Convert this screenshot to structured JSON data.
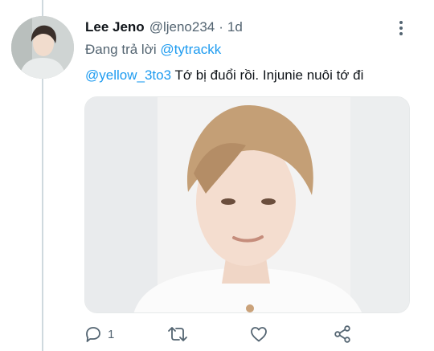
{
  "tweet": {
    "display_name": "Lee Jeno",
    "handle": "@ljeno234",
    "separator": "·",
    "time": "1d",
    "replying_prefix": "Đang trả lời",
    "replying_to": "@tytrackk",
    "mention": "@yellow_3to3",
    "text": "Tớ bị đuổi rồi. Injunie nuôi tớ đi",
    "reply_count": "1"
  },
  "colors": {
    "accent": "#1d9bf0",
    "secondary_text": "#536471",
    "primary_text": "#0f1419",
    "thread_line": "#cfd9de"
  },
  "icons": {
    "more": "more-vertical-icon",
    "reply": "reply-icon",
    "retweet": "retweet-icon",
    "like": "heart-icon",
    "share": "share-icon"
  }
}
